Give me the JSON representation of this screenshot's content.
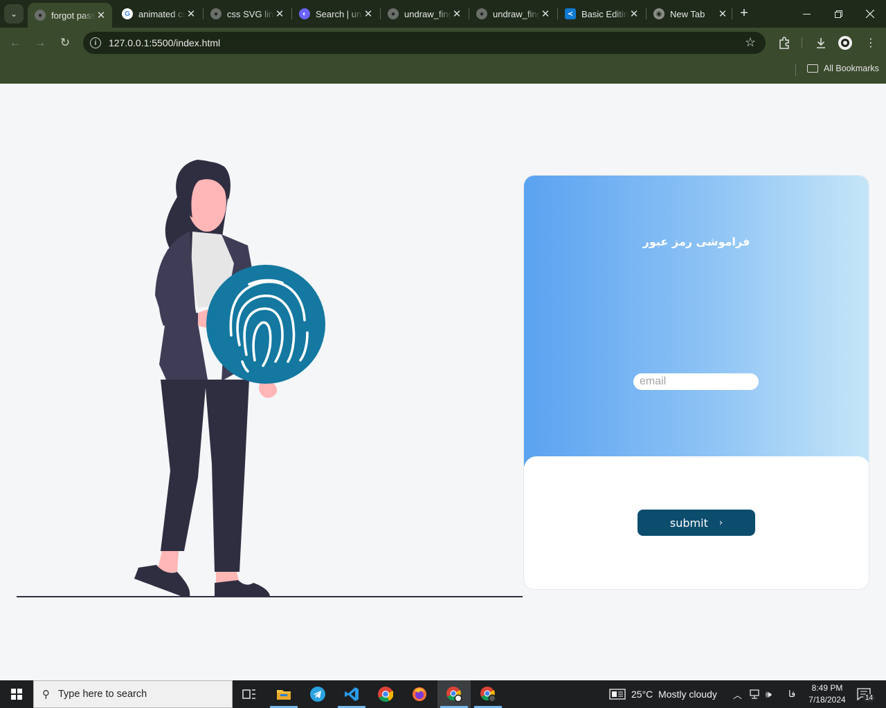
{
  "browser": {
    "tabs": [
      {
        "title": "forgot password",
        "active": true,
        "favicon": "globe-icon"
      },
      {
        "title": "animated css",
        "active": false,
        "favicon": "google-icon"
      },
      {
        "title": "css SVG line",
        "active": false,
        "favicon": "globe-icon"
      },
      {
        "title": "Search | undraw",
        "active": false,
        "favicon": "undraw-icon"
      },
      {
        "title": "undraw_fingerprint",
        "active": false,
        "favicon": "globe-icon"
      },
      {
        "title": "undraw_fingerprint",
        "active": false,
        "favicon": "globe-icon"
      },
      {
        "title": "Basic Editing",
        "active": false,
        "favicon": "vscode-icon"
      },
      {
        "title": "New Tab",
        "active": false,
        "favicon": "chrome-icon"
      }
    ],
    "url": "127.0.0.1:5500/index.html",
    "bookmarks_label": "All Bookmarks"
  },
  "form": {
    "title": "فراموشی رمز عبور",
    "email_placeholder": "email",
    "submit_label": "submit",
    "accent_color": "#0c4d6e",
    "gradient_colors": [
      "#5aa2f0",
      "#c6e6f8"
    ]
  },
  "illustration": {
    "name": "woman-holding-fingerprint",
    "fingerprint_color": "#1478a0"
  },
  "taskbar": {
    "search_placeholder": "Type here to search",
    "weather": "25°C  Mostly cloudy",
    "language": "فا",
    "time": "8:49 PM",
    "date": "7/18/2024",
    "notifications": "14"
  }
}
